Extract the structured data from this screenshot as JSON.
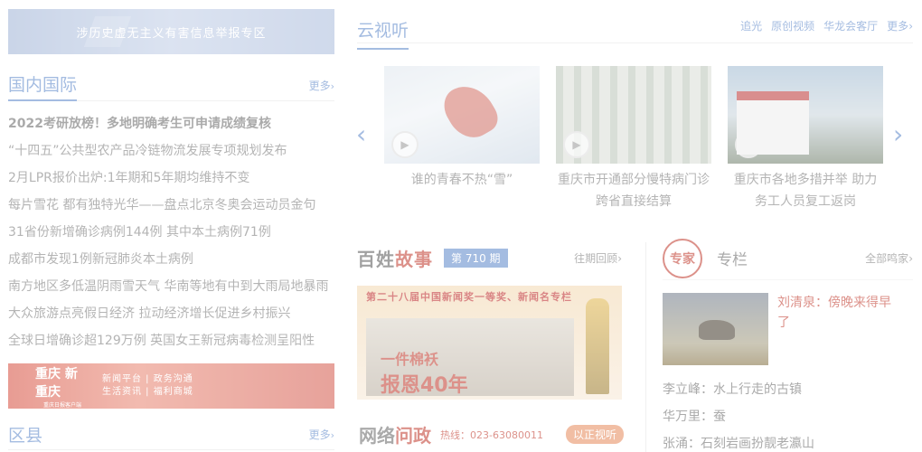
{
  "top_banner": {
    "text": "涉历史虚无主义有害信息举报专区"
  },
  "domestic": {
    "title": "国内国际",
    "more": "更多",
    "items": [
      "2022考研放榜！多地明确考生可申请成绩复核",
      "“十四五”公共型农产品冷链物流发展专项规划发布",
      "2月LPR报价出炉:1年期和5年期均维持不变",
      "每片雪花 都有独特光华——盘点北京冬奥会运动员金句",
      "31省份新增确诊病例144例 其中本土病例71例",
      "成都市发现1例新冠肺炎本土病例",
      "南方地区多低温阴雨雪天气 华南等地有中到大雨局地暴雨",
      "大众旅游点亮假日经济 拉动经济增长促进乡村振兴",
      "全球日增确诊超129万例 英国女王新冠病毒检测呈阳性"
    ]
  },
  "promo": {
    "logo": "重庆",
    "logo_text": "新重庆",
    "logo_sub": "重庆日报客户端",
    "line1": "新闻平台 | 政务沟通",
    "line2": "生活资讯 | 福利商城"
  },
  "county": {
    "title": "区县",
    "more": "更多"
  },
  "yun": {
    "title": "云视听",
    "links": [
      "追光",
      "原创视频",
      "华龙会客厅",
      "更多"
    ],
    "videos": [
      {
        "caption": "谁的青春不热“雪”"
      },
      {
        "caption": "重庆市开通部分慢特病门诊跨省直接结算"
      },
      {
        "caption": "重庆市各地多措并举 助力务工人员复工返岗"
      }
    ]
  },
  "baixing": {
    "logo_a": "百姓",
    "logo_b": "故事",
    "issue": "第 710 期",
    "back": "往期回顾",
    "strip": "第二十八届中国新闻奖一等奖、新闻名专栏",
    "photo_line1": "一件棉袄",
    "photo_line2": "报恩40年"
  },
  "wenzheng": {
    "logo_a": "网络",
    "logo_b": "问政",
    "hotline": "热线：023-63080011",
    "button": "以正视听"
  },
  "column": {
    "badge": "专家",
    "title": "专栏",
    "all": "全部鸣家",
    "featured": "刘清泉：傍晚来得早了",
    "items": [
      "李立峰：水上行走的古镇",
      "华万里：蚕",
      "张涌：石刻岩画扮靓老瀛山"
    ]
  }
}
